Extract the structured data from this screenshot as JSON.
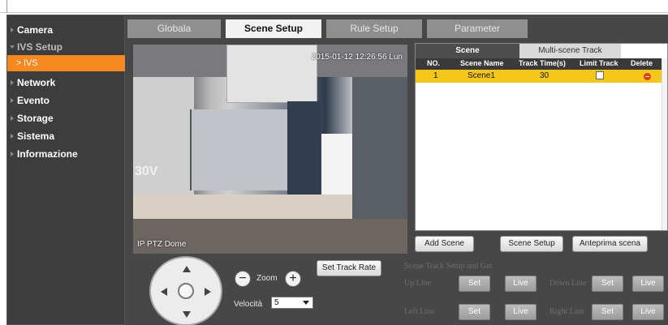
{
  "sidebar": {
    "items": [
      {
        "label": "Camera"
      },
      {
        "label": "IVS Setup"
      },
      {
        "label": "IVS"
      },
      {
        "label": "Network"
      },
      {
        "label": "Evento"
      },
      {
        "label": "Storage"
      },
      {
        "label": "Sistema"
      },
      {
        "label": "Informazione"
      }
    ],
    "sub_glyph": ">"
  },
  "tabs": [
    {
      "label": "Globala"
    },
    {
      "label": "Scene Setup"
    },
    {
      "label": "Rule Setup"
    },
    {
      "label": "Parameter"
    }
  ],
  "video": {
    "timestamp": "2015-01-12 12:26:56 Lun",
    "camera_label": "IP PTZ Dome",
    "scene_text": "30V"
  },
  "track_panel": {
    "tabs": [
      {
        "label": "Scene"
      },
      {
        "label": "Multi-scene Track"
      }
    ],
    "columns": [
      "NO.",
      "Scene Name",
      "Track Time(s)",
      "Limit Track",
      "Delete"
    ],
    "rows": [
      {
        "no": "1",
        "name": "Scene1",
        "track_time": "30",
        "limit_track": false
      }
    ]
  },
  "buttons": {
    "add_scene": "Add Scene",
    "scene_setup": "Scene Setup",
    "preview": "Anteprima scena",
    "set_track_rate": "Set Track Rate"
  },
  "ptz": {
    "zoom_label": "Zoom",
    "zoom_minus": "−",
    "zoom_plus": "+",
    "speed_label": "Velocità",
    "speed_value": "5"
  },
  "scene_track": {
    "title": "Scene Track Setup and Get",
    "up_line": "Up Line",
    "down_line": "Down Line",
    "left_line": "Left Line",
    "right_line": "Right Line",
    "set": "Set",
    "live": "Live"
  },
  "colors": {
    "sidebar_bg": "#3d3d3d",
    "active_menu": "#f4891f",
    "selected_row": "#f4c61a",
    "content_bg": "#474747"
  }
}
